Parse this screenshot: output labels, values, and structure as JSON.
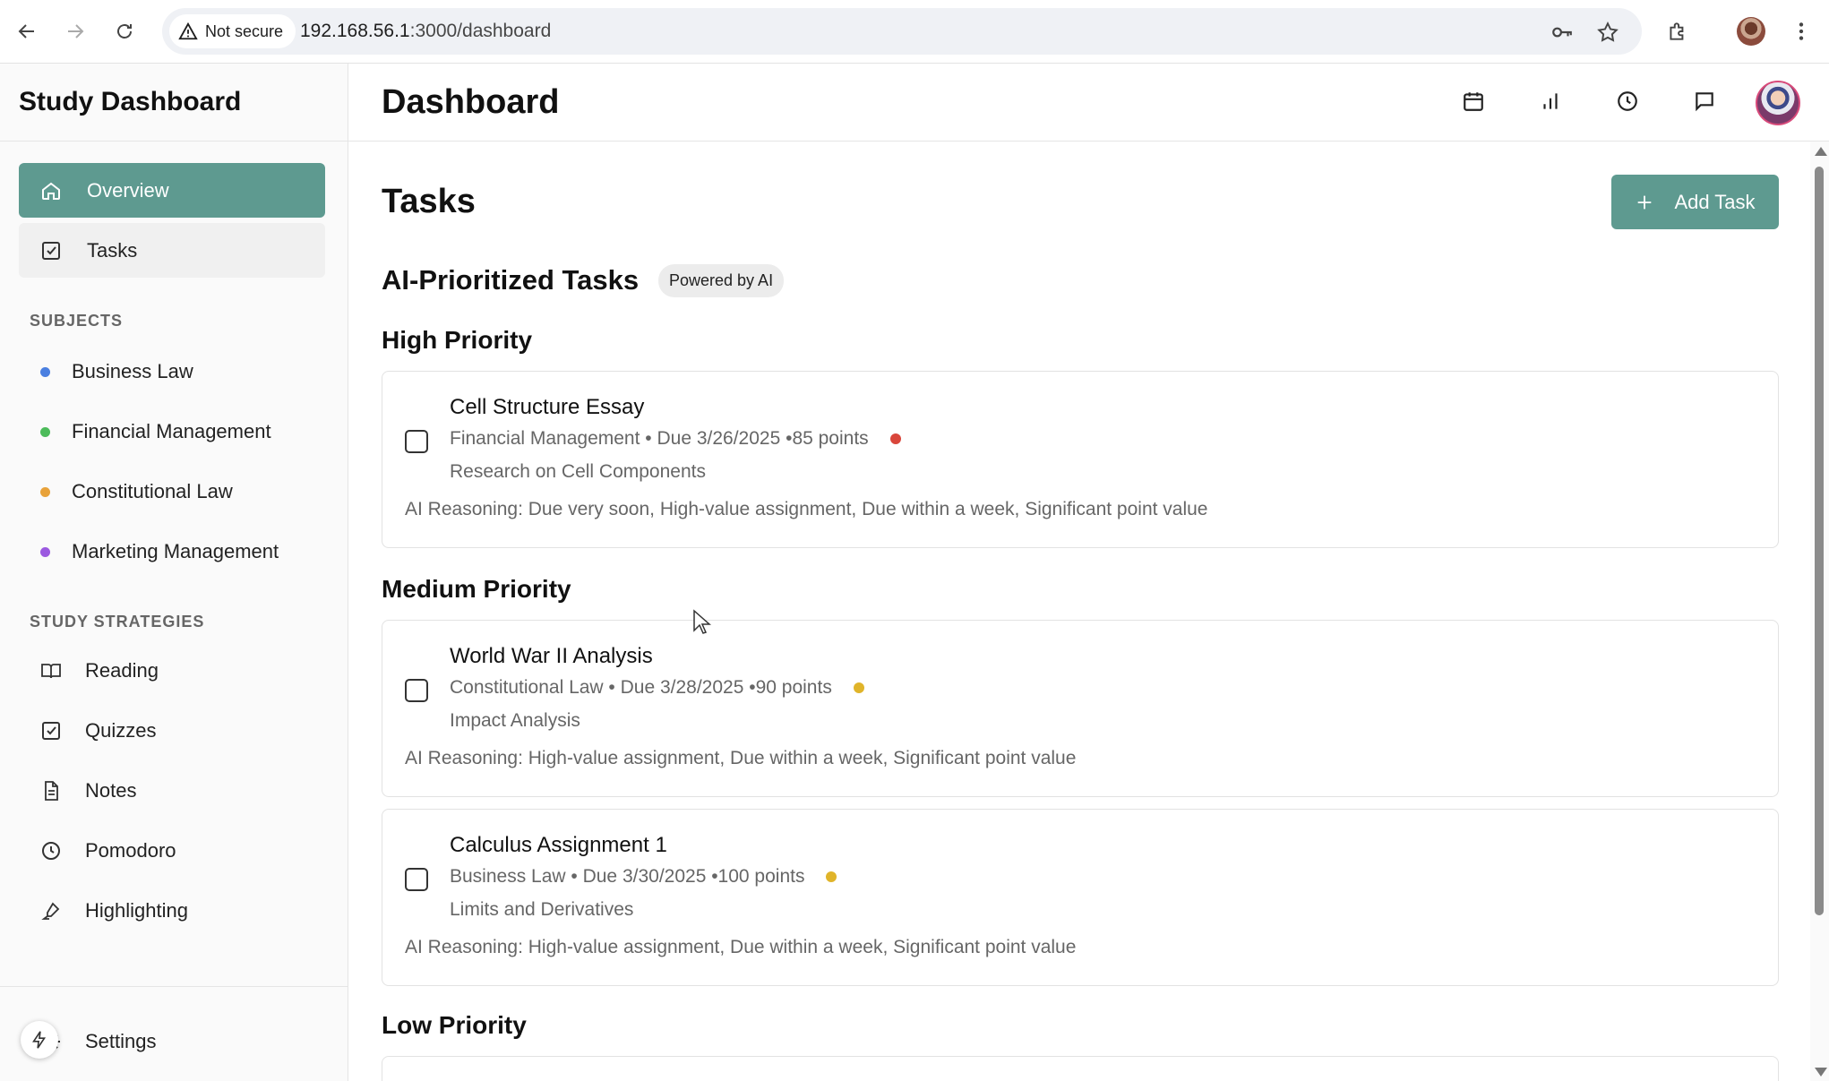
{
  "browser": {
    "security_label": "Not secure",
    "url_host": "192.168.56.1",
    "url_path": ":3000/dashboard"
  },
  "sidebar": {
    "title": "Study Dashboard",
    "nav": [
      {
        "label": "Overview",
        "icon": "home-icon",
        "active": true
      },
      {
        "label": "Tasks",
        "icon": "checkbox-icon",
        "active": false
      }
    ],
    "subjects_label": "SUBJECTS",
    "subjects": [
      {
        "label": "Business Law",
        "color": "#4a7fe0"
      },
      {
        "label": "Financial Management",
        "color": "#4cbb5a"
      },
      {
        "label": "Constitutional Law",
        "color": "#e8a23a"
      },
      {
        "label": "Marketing Management",
        "color": "#9b59e0"
      }
    ],
    "strategies_label": "STUDY STRATEGIES",
    "strategies": [
      {
        "label": "Reading",
        "icon": "book-icon"
      },
      {
        "label": "Quizzes",
        "icon": "checkbox-icon"
      },
      {
        "label": "Notes",
        "icon": "document-icon"
      },
      {
        "label": "Pomodoro",
        "icon": "clock-icon"
      },
      {
        "label": "Highlighting",
        "icon": "highlighter-icon"
      }
    ],
    "settings_label": "Settings"
  },
  "header": {
    "title": "Dashboard",
    "icons": [
      "calendar-icon",
      "bar-chart-icon",
      "clock-icon",
      "message-icon"
    ]
  },
  "main": {
    "heading": "Tasks",
    "add_button": "Add Task",
    "ai_heading": "AI-Prioritized Tasks",
    "ai_badge": "Powered by AI",
    "sections": [
      {
        "label": "High Priority",
        "tasks": [
          {
            "title": "Cell Structure Essay",
            "meta": "Financial Management • Due 3/26/2025 •85 points",
            "subtitle": "Research on Cell Components",
            "reasoning": "AI Reasoning: Due very soon, High-value assignment, Due within a week, Significant point value",
            "dot_color": "#d9463b"
          }
        ]
      },
      {
        "label": "Medium Priority",
        "tasks": [
          {
            "title": "World War II Analysis",
            "meta": "Constitutional Law • Due 3/28/2025 •90 points",
            "subtitle": "Impact Analysis",
            "reasoning": "AI Reasoning: High-value assignment, Due within a week, Significant point value",
            "dot_color": "#e0b42a"
          },
          {
            "title": "Calculus Assignment 1",
            "meta": "Business Law • Due 3/30/2025 •100 points",
            "subtitle": "Limits and Derivatives",
            "reasoning": "AI Reasoning: High-value assignment, Due within a week, Significant point value",
            "dot_color": "#e0b42a"
          }
        ]
      },
      {
        "label": "Low Priority",
        "tasks": []
      }
    ]
  },
  "colors": {
    "accent": "#5e9a90"
  }
}
